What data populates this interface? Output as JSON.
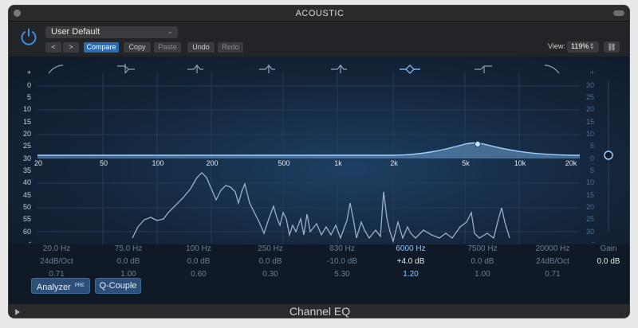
{
  "window": {
    "title": "ACOUSTIC",
    "plugin_name": "Channel EQ"
  },
  "header": {
    "preset": "User Default",
    "back": "<",
    "forward": ">",
    "compare": "Compare",
    "copy": "Copy",
    "paste": "Paste",
    "undo": "Undo",
    "redo": "Redo",
    "view_label": "View:",
    "view_value": "119%",
    "link_icon": "link-icon"
  },
  "graph": {
    "left_db_labels": [
      "+",
      "0",
      "5",
      "10",
      "15",
      "20",
      "25",
      "30",
      "35",
      "40",
      "45",
      "50",
      "55",
      "60",
      "-"
    ],
    "right_db_labels": [
      "+",
      "30",
      "25",
      "20",
      "15",
      "10",
      "5",
      "0",
      "5",
      "10",
      "15",
      "20",
      "25",
      "30",
      "-"
    ],
    "freq_labels": [
      "20",
      "50",
      "100",
      "200",
      "500",
      "1k",
      "2k",
      "5k",
      "10k",
      "20k"
    ],
    "band_shapes": [
      "low-cut-icon",
      "low-shelf-icon",
      "bell-icon",
      "bell-icon",
      "bell-icon",
      "bell-active-icon",
      "high-shelf-icon",
      "high-cut-icon"
    ]
  },
  "bands": [
    {
      "freq": "20.0 Hz",
      "gain": "24dB/Oct",
      "q": "0.71",
      "active": false
    },
    {
      "freq": "75.0 Hz",
      "gain": "0.0 dB",
      "q": "1.00",
      "active": false
    },
    {
      "freq": "100 Hz",
      "gain": "0.0 dB",
      "q": "0.60",
      "active": false
    },
    {
      "freq": "250 Hz",
      "gain": "0.0 dB",
      "q": "0.30",
      "active": false
    },
    {
      "freq": "830 Hz",
      "gain": "-10.0 dB",
      "q": "5.30",
      "active": false
    },
    {
      "freq": "6000 Hz",
      "gain": "+4.0 dB",
      "q": "1.20",
      "active": true
    },
    {
      "freq": "7500 Hz",
      "gain": "0.0 dB",
      "q": "1.00",
      "active": false
    },
    {
      "freq": "20000 Hz",
      "gain": "24dB/Oct",
      "q": "0.71",
      "active": false
    }
  ],
  "gain": {
    "label": "Gain",
    "value": "0.0 dB"
  },
  "footer": {
    "analyzer": "Analyzer",
    "analyzer_badge": "PRE",
    "qcouple": "Q-Couple"
  },
  "colors": {
    "accent": "#2d6bb0",
    "curve": "#9fd0ff",
    "analyzer": "#9ab1cc"
  }
}
